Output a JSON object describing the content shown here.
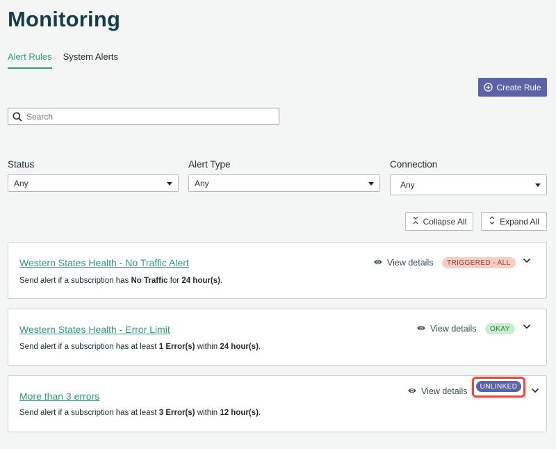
{
  "page": {
    "title": "Monitoring"
  },
  "tabs": [
    {
      "label": "Alert Rules",
      "active": true
    },
    {
      "label": "System Alerts",
      "active": false
    }
  ],
  "toolbar": {
    "create_rule_label": "Create Rule"
  },
  "search": {
    "placeholder": "Search",
    "value": ""
  },
  "filters": {
    "status": {
      "label": "Status",
      "value": "Any"
    },
    "alert_type": {
      "label": "Alert Type",
      "value": "Any"
    },
    "connection": {
      "label": "Connection",
      "value": "Any"
    }
  },
  "actions": {
    "collapse_all": "Collapse All",
    "expand_all": "Expand All"
  },
  "rules": [
    {
      "title": "Western States Health - No Traffic Alert",
      "desc_prefix": "Send alert if a subscription has ",
      "desc_b1": "No Traffic",
      "desc_mid": " for ",
      "desc_b2": "24 hour(s)",
      "desc_suffix": ".",
      "view_details": "View details",
      "status": "TRIGGERED - ALL"
    },
    {
      "title": "Western States Health - Error Limit",
      "desc_prefix": "Send alert if a subscription has at least ",
      "desc_b1": "1 Error(s)",
      "desc_mid": " within ",
      "desc_b2": "24 hour(s)",
      "desc_suffix": ".",
      "view_details": "View details",
      "status": "OKAY"
    },
    {
      "title": "More than 3 errors",
      "desc_prefix": "Send alert if a subscription has at least ",
      "desc_b1": "3 Error(s)",
      "desc_mid": " within ",
      "desc_b2": "12 hour(s)",
      "desc_suffix": ".",
      "view_details": "View details",
      "status": "UNLINKED"
    }
  ],
  "colors": {
    "accent_green": "#2e9c7a",
    "primary_button": "#5b63a6",
    "title": "#163e4a",
    "highlight": "#e04e3f"
  },
  "icons": [
    "plus-circle-icon",
    "search-icon",
    "caret-down-icon",
    "collapse-icon",
    "expand-icon",
    "eye-icon",
    "chevron-down-icon"
  ]
}
